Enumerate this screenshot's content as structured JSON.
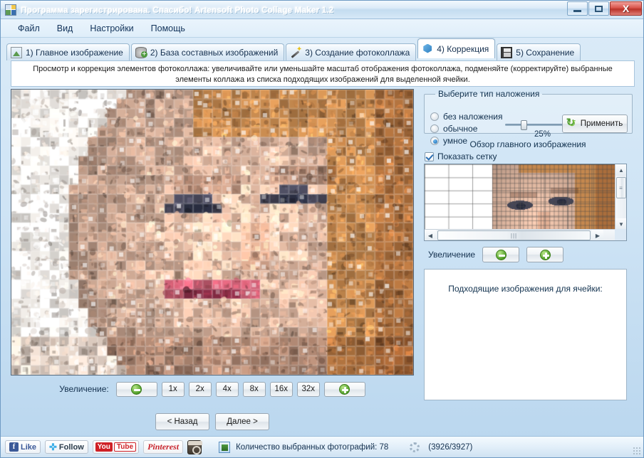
{
  "window": {
    "title": "Программа зарегистрирована. Спасибо! Artensoft Photo Collage Maker 1.2",
    "app_icon": "app-logo-icon",
    "minimize": "–",
    "maximize": "□",
    "close": "X"
  },
  "menu": {
    "items": [
      {
        "label": "Файл"
      },
      {
        "label": "Вид"
      },
      {
        "label": "Настройки"
      },
      {
        "label": "Помощь"
      }
    ]
  },
  "tabs": [
    {
      "label": "1) Главное изображение",
      "icon": "photo-icon",
      "active": false
    },
    {
      "label": "2) База составных изображений",
      "icon": "database-icon",
      "active": false
    },
    {
      "label": "3) Создание фотоколлажа",
      "icon": "magic-wand-icon",
      "active": false
    },
    {
      "label": "4) Коррекция",
      "icon": "cube-icon",
      "active": true
    },
    {
      "label": "5) Сохранение",
      "icon": "floppy-save-icon",
      "active": false
    }
  ],
  "description": "Просмотр и коррекция элементов фотоколлажа: увеличивайте или уменьшайте масштаб отображения фотоколлажа, подменяйте (корректируйте) выбранные элементы коллажа из списка подходящих изображений для выделенной ячейки.",
  "overlay": {
    "legend": "Выберите тип наложения",
    "options": [
      {
        "label": "без наложения",
        "selected": false
      },
      {
        "label": "обычное",
        "selected": false
      },
      {
        "label": "умное",
        "selected": true
      }
    ],
    "slider_value": "25%",
    "slider_percent": 25,
    "apply_label": "Применить",
    "apply_icon": "refresh-green-icon"
  },
  "overview": {
    "title": "Обзор главного изображения",
    "show_grid_label": "Показать сетку",
    "show_grid_checked": true,
    "scroll_left_icon": "arrow-left-icon",
    "scroll_right_icon": "arrow-right-icon",
    "scroll_up_icon": "arrow-up-icon",
    "scroll_down_icon": "arrow-down-icon",
    "zoom_label": "Увеличение",
    "zoom_out_icon": "zoom-out-icon",
    "zoom_in_icon": "zoom-in-icon"
  },
  "cell_panel": {
    "title": "Подходящие изображения для ячейки:"
  },
  "collage_zoom": {
    "label": "Увеличение:",
    "zoom_out_icon": "zoom-out-icon",
    "zoom_in_icon": "zoom-in-icon",
    "levels": [
      "1x",
      "2x",
      "4x",
      "8x",
      "16x",
      "32x"
    ],
    "selected": "1x"
  },
  "navigation": {
    "back_label": "< Назад",
    "next_label": "Далее >"
  },
  "statusbar": {
    "social": [
      {
        "name": "facebook-like-button",
        "label": "Like"
      },
      {
        "name": "twitter-follow-button",
        "label": "Follow"
      },
      {
        "name": "youtube-button",
        "label_1": "You",
        "label_2": "Tube"
      },
      {
        "name": "pinterest-button",
        "label": "Pinterest"
      },
      {
        "name": "instagram-button",
        "label": ""
      }
    ],
    "photo_count_text": "Количество выбранных фотографий: 78",
    "progress_text": "(3926/3927)"
  },
  "colors": {
    "title_text": "#ffffff",
    "accent_blue": "#2b6fb5",
    "green": "#4f9e27",
    "close_red": "#b93229",
    "panel_border": "#9fb6c9"
  }
}
